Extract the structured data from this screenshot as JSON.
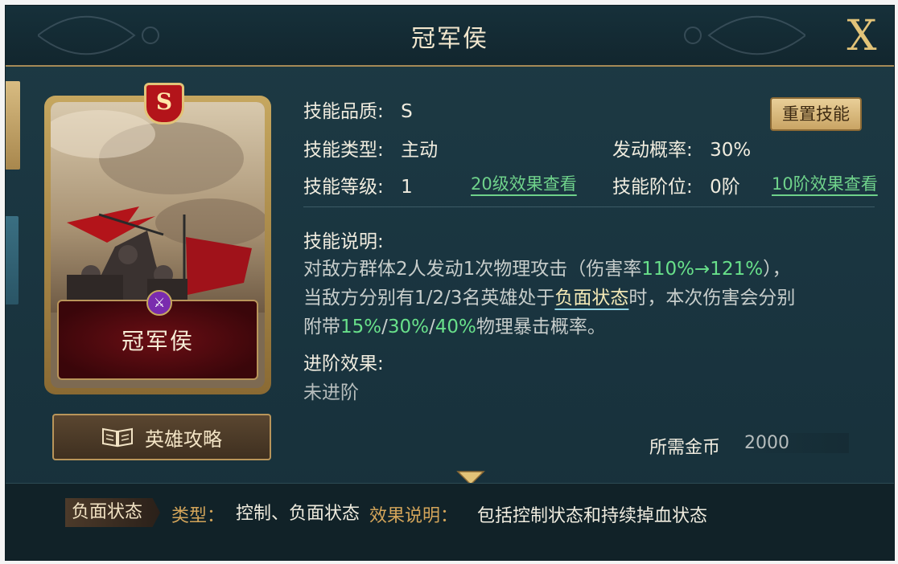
{
  "header": {
    "title": "冠军侯",
    "close_label": "X"
  },
  "card": {
    "grade": "S",
    "name": "冠军侯"
  },
  "guide_button": {
    "label": "英雄攻略"
  },
  "skill": {
    "quality_label": "技能品质:",
    "quality_value": "S",
    "reset_label": "重置技能",
    "type_label": "技能类型:",
    "type_value": "主动",
    "chance_label": "发动概率:",
    "chance_value": "30%",
    "level_label": "技能等级:",
    "level_value": "1",
    "level20_link": "20级效果查看",
    "rank_label": "技能阶位:",
    "rank_value": "0阶",
    "rank10_link": "10阶效果查看",
    "desc_label": "技能说明:",
    "desc_line1_a": "对敌方群体2人发动1次物理攻击（伤害率",
    "desc_line1_hl": "110%→121%",
    "desc_line1_b": "），",
    "desc_line2_a": "当敌方分别有1/2/3名英雄处于",
    "desc_line2_kw": "负面状态",
    "desc_line2_b": "时，本次伤害会分别",
    "desc_line3_a": "附带",
    "desc_line3_hl1": "15%",
    "desc_line3_sep1": "/",
    "desc_line3_hl2": "30%",
    "desc_line3_sep2": "/",
    "desc_line3_hl3": "40%",
    "desc_line3_b": "物理暴击概率。",
    "advance_label": "进阶效果:",
    "advance_value": "未进阶"
  },
  "cost": {
    "label": "所需金币",
    "value": "2000"
  },
  "footer": {
    "tag": "负面状态",
    "type_label": "类型：",
    "type_value": "控制、负面状态",
    "effect_label": "效果说明：",
    "effect_value": "包括控制状态和持续掉血状态"
  },
  "colors": {
    "accent_gold": "#c6a75f",
    "highlight_green": "#68e08a",
    "panel_bg": "#1a3540"
  }
}
